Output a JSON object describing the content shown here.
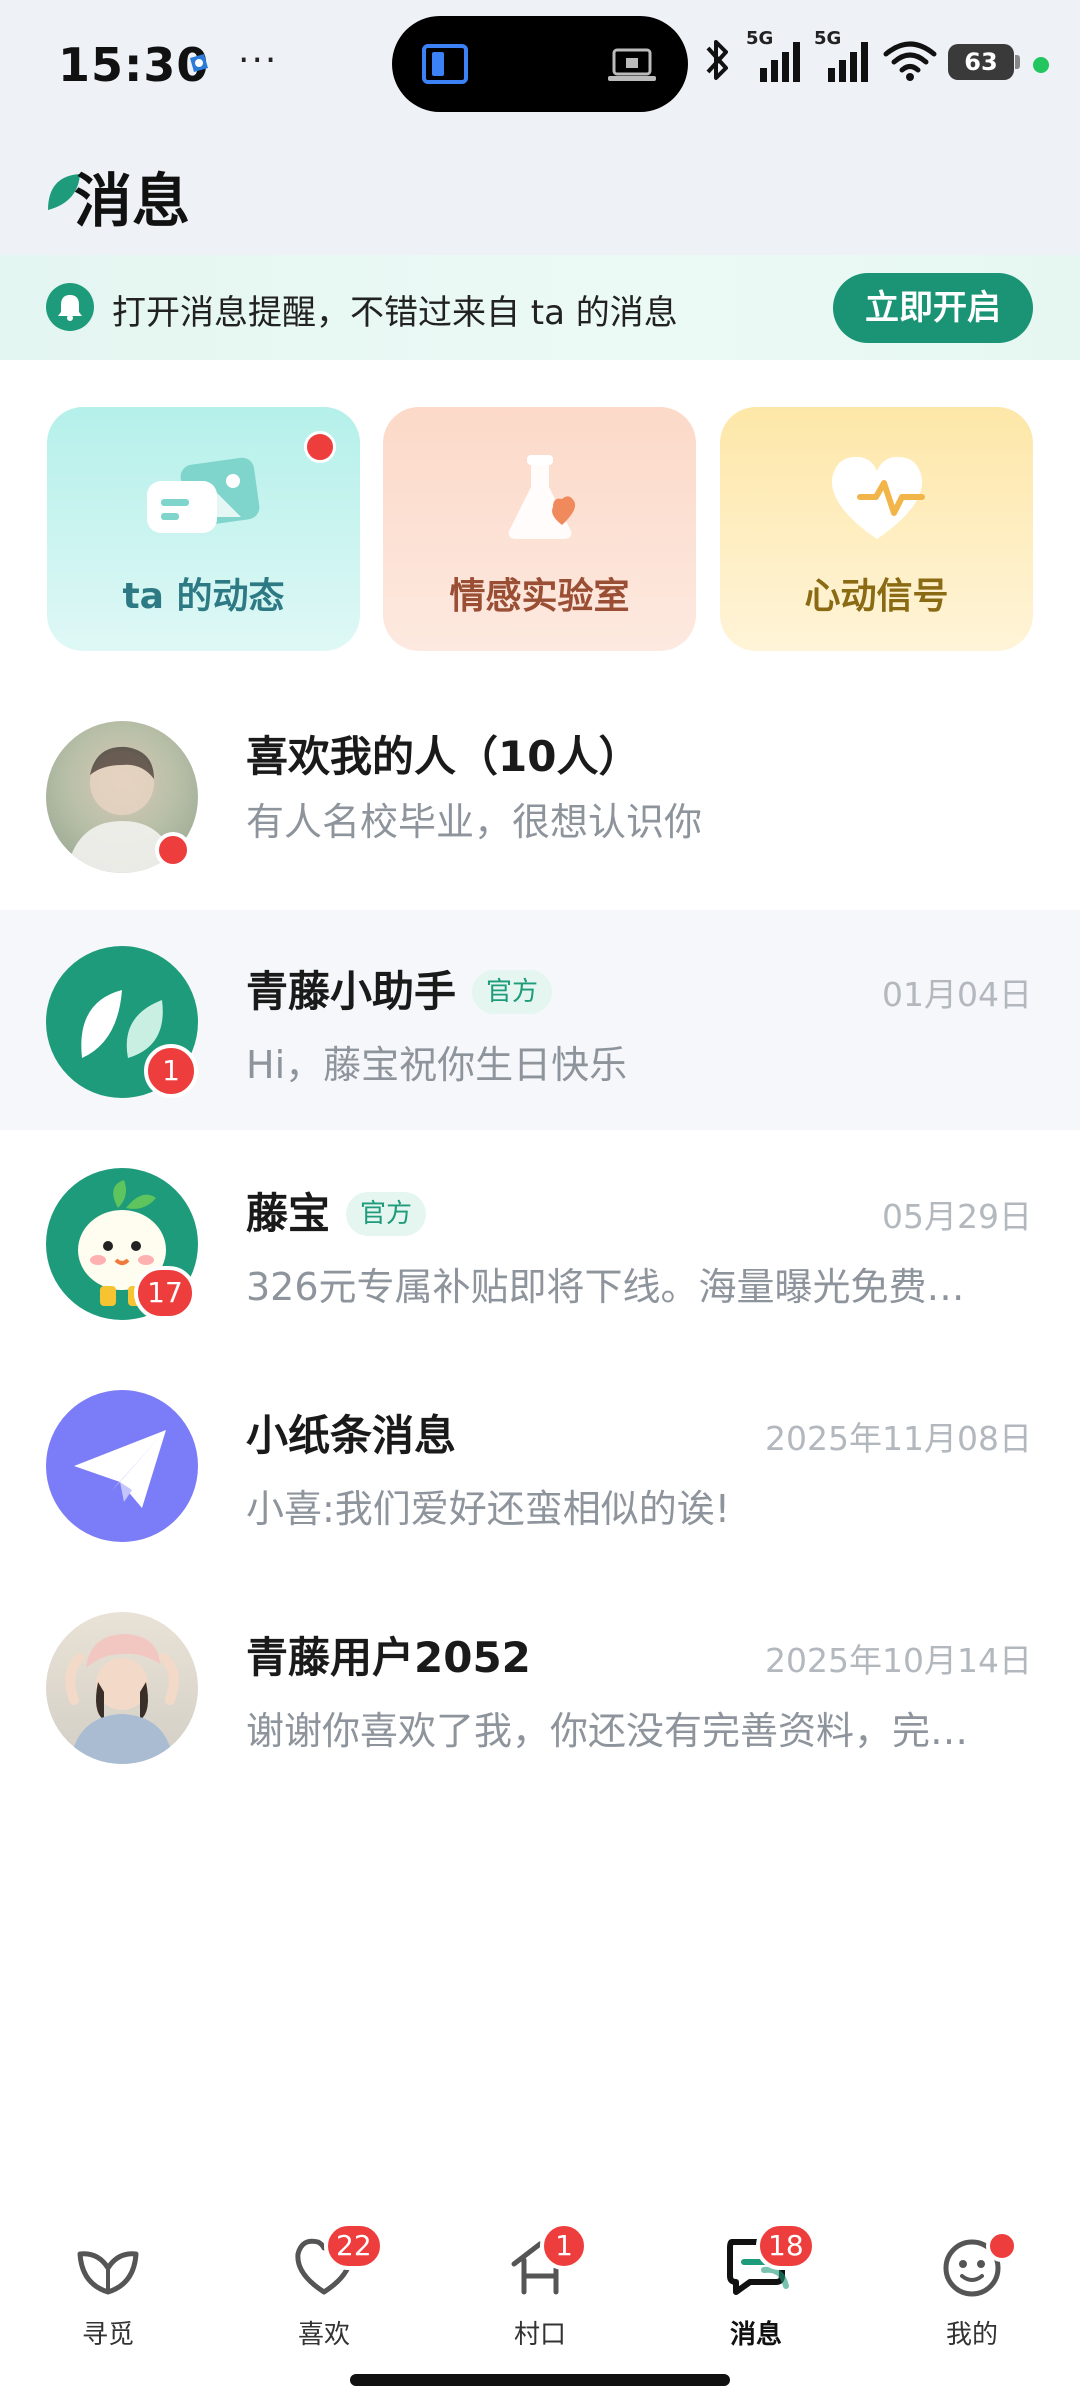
{
  "status_bar": {
    "time": "15:30",
    "more": "···",
    "signal_1_label": "5G",
    "signal_2_label": "5G",
    "battery": "63"
  },
  "header": {
    "title": "消息"
  },
  "notify_banner": {
    "text": "打开消息提醒，不错过来自 ta 的消息",
    "button": "立即开启"
  },
  "cards": [
    {
      "label": "ta 的动态",
      "icon": "photo-chat-icon",
      "has_dot": true
    },
    {
      "label": "情感实验室",
      "icon": "flask-heart-icon",
      "has_dot": false
    },
    {
      "label": "心动信号",
      "icon": "heart-pulse-icon",
      "has_dot": false
    }
  ],
  "messages": [
    {
      "name": "喜欢我的人（10人）",
      "preview": "有人名校毕业，很想认识你",
      "date": "",
      "official": false,
      "badge": "dot"
    },
    {
      "name": "青藤小助手",
      "official_tag": "官方",
      "preview": "Hi，藤宝祝你生日快乐",
      "date": "01月04日",
      "badge": "1"
    },
    {
      "name": "藤宝",
      "official_tag": "官方",
      "preview": "326元专属补贴即将下线。海量曝光免费…",
      "date": "05月29日",
      "badge": "17"
    },
    {
      "name": "小纸条消息",
      "preview": "小喜:我们爱好还蛮相似的诶!",
      "date": "2025年11月08日",
      "badge": ""
    },
    {
      "name": "青藤用户2052",
      "preview": "谢谢你喜欢了我，你还没有完善资料，完…",
      "date": "2025年10月14日",
      "badge": ""
    }
  ],
  "bottom_nav": [
    {
      "label": "寻觅",
      "icon": "leaf-icon",
      "badge": ""
    },
    {
      "label": "喜欢",
      "icon": "heart-icon",
      "badge": "22"
    },
    {
      "label": "村口",
      "icon": "village-icon",
      "badge": "1"
    },
    {
      "label": "消息",
      "icon": "chat-icon",
      "badge": "18",
      "active": true
    },
    {
      "label": "我的",
      "icon": "face-icon",
      "badge": "dot"
    }
  ],
  "colors": {
    "accent": "#1a9474",
    "badge": "#ee3d3d",
    "official_tag_bg": "#e4f6ef",
    "preview_text": "#8e949c"
  }
}
